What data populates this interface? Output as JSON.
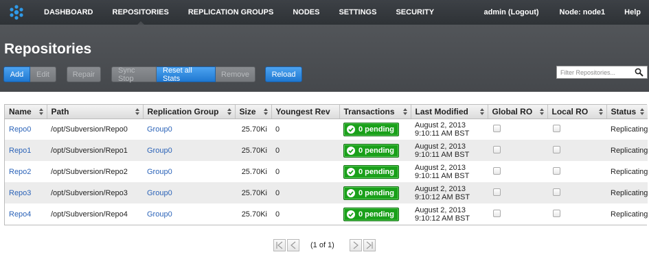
{
  "nav": {
    "items": [
      "DASHBOARD",
      "REPOSITORIES",
      "REPLICATION GROUPS",
      "NODES",
      "SETTINGS",
      "SECURITY"
    ],
    "active_index": 1,
    "user": "admin (Logout)",
    "node": "Node: node1",
    "help": "Help"
  },
  "page": {
    "title": "Repositories"
  },
  "toolbar": {
    "add": "Add",
    "edit": "Edit",
    "repair": "Repair",
    "sync_stop": "Sync Stop",
    "reset_all_stats": "Reset all Stats",
    "remove": "Remove",
    "reload": "Reload"
  },
  "filter": {
    "placeholder": "Filter Repositories..."
  },
  "table": {
    "columns": [
      "Name",
      "Path",
      "Replication Group",
      "Size",
      "Youngest Rev",
      "Transactions",
      "Last Modified",
      "Global RO",
      "Local RO",
      "Status"
    ],
    "rows": [
      {
        "name": "Repo0",
        "path": "/opt/Subversion/Repo0",
        "group": "Group0",
        "size": "25.70Ki",
        "rev": "0",
        "tx": "0 pending",
        "date": "August 2, 2013",
        "time": "9:10:11 AM BST",
        "status": "Replicating"
      },
      {
        "name": "Repo1",
        "path": "/opt/Subversion/Repo1",
        "group": "Group0",
        "size": "25.70Ki",
        "rev": "0",
        "tx": "0 pending",
        "date": "August 2, 2013",
        "time": "9:10:11 AM BST",
        "status": "Replicating"
      },
      {
        "name": "Repo2",
        "path": "/opt/Subversion/Repo2",
        "group": "Group0",
        "size": "25.70Ki",
        "rev": "0",
        "tx": "0 pending",
        "date": "August 2, 2013",
        "time": "9:10:11 AM BST",
        "status": "Replicating"
      },
      {
        "name": "Repo3",
        "path": "/opt/Subversion/Repo3",
        "group": "Group0",
        "size": "25.70Ki",
        "rev": "0",
        "tx": "0 pending",
        "date": "August 2, 2013",
        "time": "9:10:12 AM BST",
        "status": "Replicating"
      },
      {
        "name": "Repo4",
        "path": "/opt/Subversion/Repo4",
        "group": "Group0",
        "size": "25.70Ki",
        "rev": "0",
        "tx": "0 pending",
        "date": "August 2, 2013",
        "time": "9:10:12 AM BST",
        "status": "Replicating"
      }
    ]
  },
  "pager": {
    "text": "(1 of 1)"
  },
  "colors": {
    "nav_bg": "#34383c",
    "header_bg": "#4b4e52",
    "primary_button": "#2a8ae4",
    "pending_green": "#1aa01a",
    "link": "#2b63b8"
  },
  "icons": {
    "logo": "cluster-logo-icon",
    "search": "magnifier-icon",
    "pending": "check-circle-icon",
    "sort": "sort-arrows-icon"
  }
}
